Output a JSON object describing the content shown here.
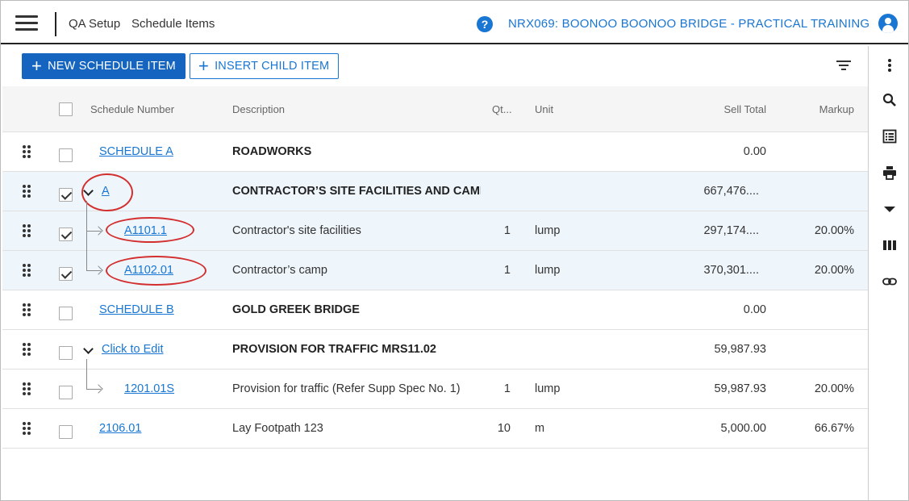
{
  "header": {
    "breadcrumb_1": "QA Setup",
    "breadcrumb_2": "Schedule Items",
    "help_symbol": "?",
    "project_title": "NRX069: BOONOO BOONOO BRIDGE - PRACTICAL TRAINING"
  },
  "toolbar": {
    "new_label": "NEW SCHEDULE ITEM",
    "insert_child_label": "INSERT CHILD ITEM",
    "plus_symbol": "+"
  },
  "columns": {
    "schedule_number": "Schedule Number",
    "description": "Description",
    "quantity": "Qt...",
    "unit": "Unit",
    "sell_total": "Sell Total",
    "markup": "Markup"
  },
  "rows": [
    {
      "number": "SCHEDULE A",
      "description": "ROADWORKS",
      "qty": "",
      "unit": "",
      "sell_total": "0.00",
      "markup": ""
    },
    {
      "number": "A",
      "description": "CONTRACTOR’S SITE FACILITIES AND CAMP",
      "qty": "",
      "unit": "",
      "sell_total": "667,476....",
      "markup": ""
    },
    {
      "number": "A1101.1",
      "description": "Contractor's site facilities",
      "qty": "1",
      "unit": "lump",
      "sell_total": "297,174....",
      "markup": "20.00%"
    },
    {
      "number": "A1102.01",
      "description": "Contractor’s camp",
      "qty": "1",
      "unit": "lump",
      "sell_total": "370,301....",
      "markup": "20.00%"
    },
    {
      "number": "SCHEDULE B",
      "description": "GOLD GREEK BRIDGE",
      "qty": "",
      "unit": "",
      "sell_total": "0.00",
      "markup": ""
    },
    {
      "number": "Click to Edit",
      "description": "PROVISION FOR TRAFFIC MRS11.02",
      "qty": "",
      "unit": "",
      "sell_total": "59,987.93",
      "markup": ""
    },
    {
      "number": "1201.01S",
      "description": "Provision for traffic (Refer Supp Spec No. 1)",
      "qty": "1",
      "unit": "lump",
      "sell_total": "59,987.93",
      "markup": "20.00%"
    },
    {
      "number": "2106.01",
      "description": "Lay Footpath 123",
      "qty": "10",
      "unit": "m",
      "sell_total": "5,000.00",
      "markup": "66.67%"
    }
  ],
  "colors": {
    "primary": "#1565c0",
    "link": "#1976d2",
    "selected_row": "#eef5fb",
    "annotation": "#d32f2f"
  },
  "rail_icons": [
    "more-vert-icon",
    "search-icon",
    "list-icon",
    "print-icon",
    "dropdown-icon",
    "columns-icon",
    "link-icon"
  ]
}
